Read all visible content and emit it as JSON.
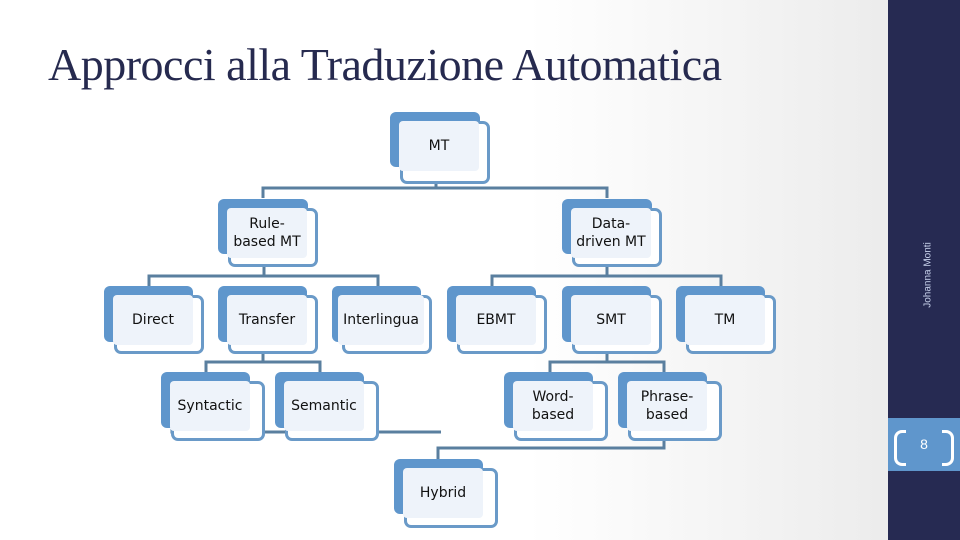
{
  "slide": {
    "title": "Approcci alla Traduzione Automatica",
    "author": "Johanna Monti",
    "page_number": "8"
  },
  "colors": {
    "accent_blue": "#5f96cc",
    "outline_blue": "#6a9ac8",
    "connector": "#5a7f9f",
    "sidebar_navy": "#262a52",
    "title_text": "#262a4f"
  },
  "diagram": {
    "nodes": [
      {
        "id": "mt",
        "label": "MT"
      },
      {
        "id": "rule_based",
        "label": "Rule-\nbased MT"
      },
      {
        "id": "data_driven",
        "label": "Data-\ndriven MT"
      },
      {
        "id": "direct",
        "label": "Direct"
      },
      {
        "id": "transfer",
        "label": "Transfer"
      },
      {
        "id": "interlingua",
        "label": "Interlingua"
      },
      {
        "id": "ebmt",
        "label": "EBMT"
      },
      {
        "id": "smt",
        "label": "SMT"
      },
      {
        "id": "tm",
        "label": "TM"
      },
      {
        "id": "syntactic",
        "label": "Syntactic"
      },
      {
        "id": "semantic",
        "label": "Semantic"
      },
      {
        "id": "word_based",
        "label": "Word-\nbased"
      },
      {
        "id": "phrase_based",
        "label": "Phrase-\nbased"
      },
      {
        "id": "hybrid",
        "label": "Hybrid"
      }
    ],
    "edges": [
      [
        "mt",
        "rule_based"
      ],
      [
        "mt",
        "data_driven"
      ],
      [
        "rule_based",
        "direct"
      ],
      [
        "rule_based",
        "transfer"
      ],
      [
        "rule_based",
        "interlingua"
      ],
      [
        "data_driven",
        "ebmt"
      ],
      [
        "data_driven",
        "smt"
      ],
      [
        "data_driven",
        "tm"
      ],
      [
        "transfer",
        "syntactic"
      ],
      [
        "transfer",
        "semantic"
      ],
      [
        "smt",
        "word_based"
      ],
      [
        "smt",
        "phrase_based"
      ],
      [
        "syntactic",
        "hybrid"
      ],
      [
        "phrase_based",
        "hybrid"
      ]
    ]
  }
}
